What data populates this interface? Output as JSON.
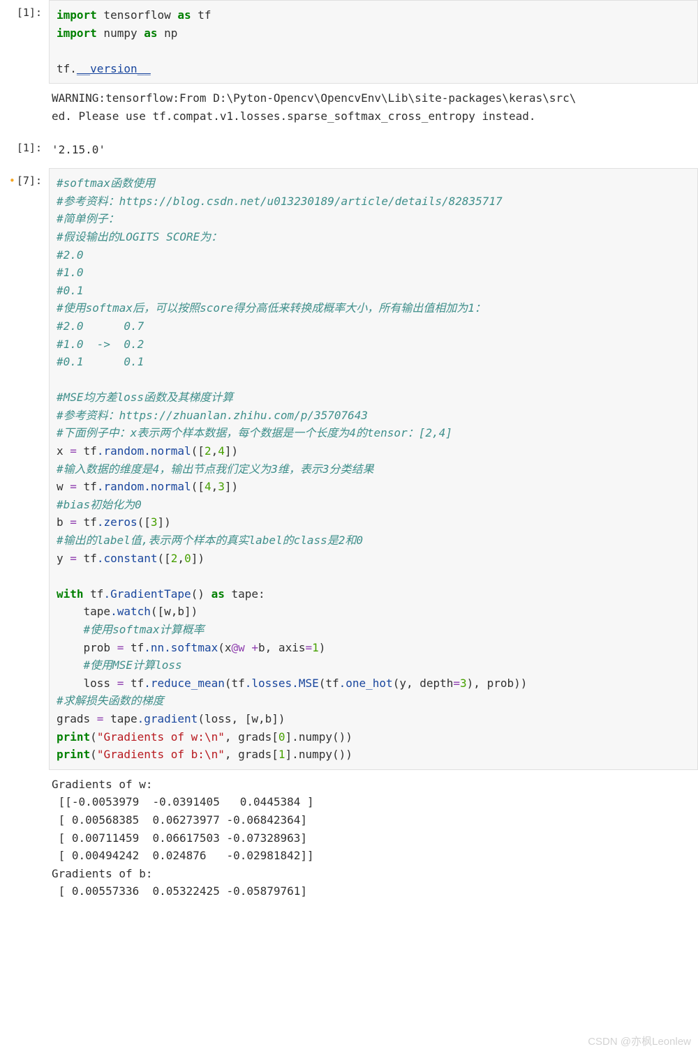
{
  "cells": {
    "c1": {
      "prompt": "[1]:",
      "code": {
        "l1_kw1": "import",
        "l1_id": " tensorflow ",
        "l1_kw2": "as",
        "l1_id2": " tf",
        "l2_kw1": "import",
        "l2_id": " numpy ",
        "l2_kw2": "as",
        "l2_id2": " np",
        "l4_id": "tf.",
        "l4_dunder": "__version__"
      },
      "stream": "WARNING:tensorflow:From D:\\Pyton-Opencv\\OpencvEnv\\Lib\\site-packages\\keras\\src\\\ned. Please use tf.compat.v1.losses.sparse_softmax_cross_entropy instead."
    },
    "c1out": {
      "prompt": "[1]:",
      "result": "'2.15.0'"
    },
    "c7": {
      "prompt": "[7]:",
      "code": {
        "cm1": "#softmax函数使用",
        "cm2": "#参考资料：https://blog.csdn.net/u013230189/article/details/82835717",
        "cm3": "#简单例子：",
        "cm4": "#假设输出的LOGITS SCORE为：",
        "cm5": "#2.0",
        "cm6": "#1.0",
        "cm7": "#0.1",
        "cm8": "#使用softmax后，可以按照score得分高低来转换成概率大小，所有输出值相加为1：",
        "cm9": "#2.0      0.7",
        "cm10": "#1.0  ->  0.2",
        "cm11": "#0.1      0.1",
        "blank1": "",
        "cm12": "#MSE均方差loss函数及其梯度计算",
        "cm13": "#参考资料：https://zhuanlan.zhihu.com/p/35707643",
        "cm14": "#下面例子中：x表示两个样本数据，每个数据是一个长度为4的tensor：[2,4]",
        "a1_l": "x ",
        "a1_op": "=",
        "a1_r1": " tf",
        "a1_r2": ".random.normal",
        "a1_p": "([",
        "a1_n1": "2",
        "a1_c": ",",
        "a1_n2": "4",
        "a1_pe": "])",
        "cm15": "#输入数据的维度是4，输出节点我们定义为3维，表示3分类结果",
        "a2_l": "w ",
        "a2_op": "=",
        "a2_r1": " tf",
        "a2_r2": ".random.normal",
        "a2_p": "([",
        "a2_n1": "4",
        "a2_c": ",",
        "a2_n2": "3",
        "a2_pe": "])",
        "cm16": "#bias初始化为0",
        "a3_l": "b ",
        "a3_op": "=",
        "a3_r1": " tf",
        "a3_r2": ".zeros",
        "a3_p": "([",
        "a3_n": "3",
        "a3_pe": "])",
        "cm17": "#输出的label值,表示两个样本的真实label的class是2和0",
        "a4_l": "y ",
        "a4_op": "=",
        "a4_r1": " tf",
        "a4_r2": ".constant",
        "a4_p": "([",
        "a4_n1": "2",
        "a4_c": ",",
        "a4_n2": "0",
        "a4_pe": "])",
        "blank2": "",
        "w_kw": "with",
        "w_r1": " tf",
        "w_r2": ".GradientTape",
        "w_p": "() ",
        "w_kw2": "as",
        "w_id": " tape:",
        "wl1_pre": "    tape",
        "wl1_r2": ".watch",
        "wl1_p": "([w,b])",
        "wcm1": "    #使用softmax计算概率",
        "wl2_pre": "    prob ",
        "wl2_op": "=",
        "wl2_r1": " tf",
        "wl2_r2": ".nn.softmax",
        "wl2_p": "(x",
        "wl2_at": "@w ",
        "wl2_plus": "+",
        "wl2_b": "b, axis",
        "wl2_eq": "=",
        "wl2_n": "1",
        "wl2_pe": ")",
        "wcm2": "    #使用MSE计算loss",
        "wl3_pre": "    loss ",
        "wl3_op": "=",
        "wl3_r1": " tf",
        "wl3_r2": ".reduce_mean",
        "wl3_p": "(tf",
        "wl3_r3": ".losses.MSE",
        "wl3_p2": "(tf",
        "wl3_r4": ".one_hot",
        "wl3_p3": "(y, depth",
        "wl3_eq": "=",
        "wl3_n": "3",
        "wl3_p4": "), prob))",
        "cm18": "#求解损失函数的梯度",
        "g1_l": "grads ",
        "g1_op": "=",
        "g1_r1": " tape",
        "g1_r2": ".gradient",
        "g1_p": "(loss, [w,b])",
        "p1_l": "print",
        "p1_p": "(",
        "p1_s": "\"Gradients of w:\\n\"",
        "p1_c": ", grads[",
        "p1_n": "0",
        "p1_r": "].numpy",
        "p1_pe": "())",
        "p2_l": "print",
        "p2_p": "(",
        "p2_s": "\"Gradients of b:\\n\"",
        "p2_c": ", grads[",
        "p2_n": "1",
        "p2_r": "].numpy",
        "p2_pe": "())"
      },
      "stream": "Gradients of w:\n [[-0.0053979  -0.0391405   0.0445384 ]\n [ 0.00568385  0.06273977 -0.06842364]\n [ 0.00711459  0.06617503 -0.07328963]\n [ 0.00494242  0.024876   -0.02981842]]\nGradients of b:\n [ 0.00557336  0.05322425 -0.05879761]"
    }
  },
  "watermark": "CSDN @亦枫Leonlew"
}
